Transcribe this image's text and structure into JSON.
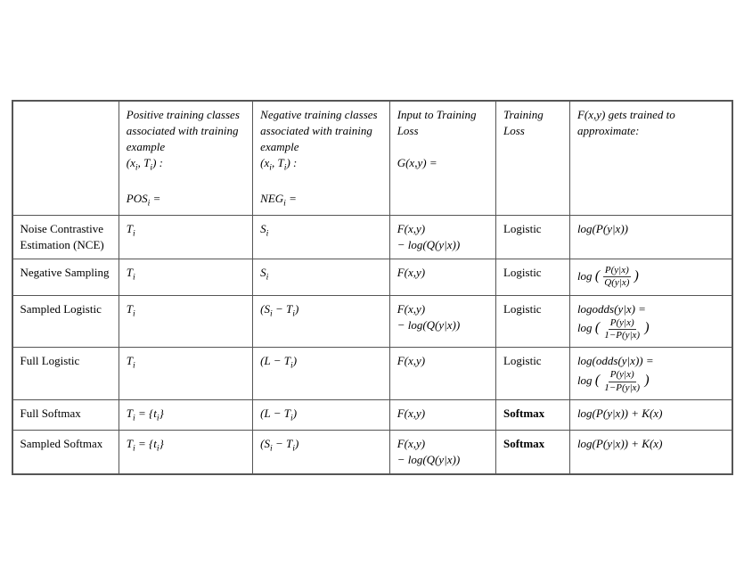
{
  "table": {
    "headers": {
      "col1": "",
      "col2_line1": "Positive training",
      "col2_line2": "classes",
      "col2_line3": "associated with",
      "col2_line4": "training example",
      "col2_line5": "(xᵢ, Tᵢ) :",
      "col2_line6": "POSᵢ =",
      "col3_line1": "Negative training",
      "col3_line2": "classes",
      "col3_line3": "associated with",
      "col3_line4": "training example",
      "col3_line5": "(xᵢ, Tᵢ) :",
      "col3_line6": "NEGᵢ =",
      "col4_line1": "Input to",
      "col4_line2": "Training",
      "col4_line3": "Loss",
      "col4_line4": "G(x,y) =",
      "col5": "Training Loss",
      "col6_line1": "F(x,y) gets",
      "col6_line2": "trained to",
      "col6_line3": "approximate:"
    },
    "rows": [
      {
        "name": "Noise Contrastive Estimation (NCE)",
        "pos": "Tᵢ",
        "neg": "Sᵢ",
        "input": "F(x,y) − log(Q(y|x))",
        "loss": "Logistic",
        "approx": "log(P(y|x))"
      },
      {
        "name": "Negative Sampling",
        "pos": "Tᵢ",
        "neg": "Sᵢ",
        "input": "F(x,y)",
        "loss": "Logistic",
        "approx": "log(P(y|x)/Q(y|x))"
      },
      {
        "name": "Sampled Logistic",
        "pos": "Tᵢ",
        "neg": "(Sᵢ − Tᵢ)",
        "input": "F(x,y) − log(Q(y|x))",
        "loss": "Logistic",
        "approx": "logodds(y|x) = log(P(y|x)/(1−P(y|x)))"
      },
      {
        "name": "Full Logistic",
        "pos": "Tᵢ",
        "neg": "(L − Tᵢ)",
        "input": "F(x,y)",
        "loss": "Logistic",
        "approx": "log(odds(y|x)) = log(P(y|x)/(1−P(y|x)))"
      },
      {
        "name": "Full Softmax",
        "pos": "Tᵢ = {tᵢ}",
        "neg": "(L − Tᵢ)",
        "input": "F(x,y)",
        "loss": "Softmax",
        "approx": "log(P(y|x)) + K(x)"
      },
      {
        "name": "Sampled Softmax",
        "pos": "Tᵢ = {tᵢ}",
        "neg": "(Sᵢ − Tᵢ)",
        "input": "F(x,y) − log(Q(y|x))",
        "loss": "Softmax",
        "approx": "log(P(y|x)) + K(x)"
      }
    ]
  }
}
